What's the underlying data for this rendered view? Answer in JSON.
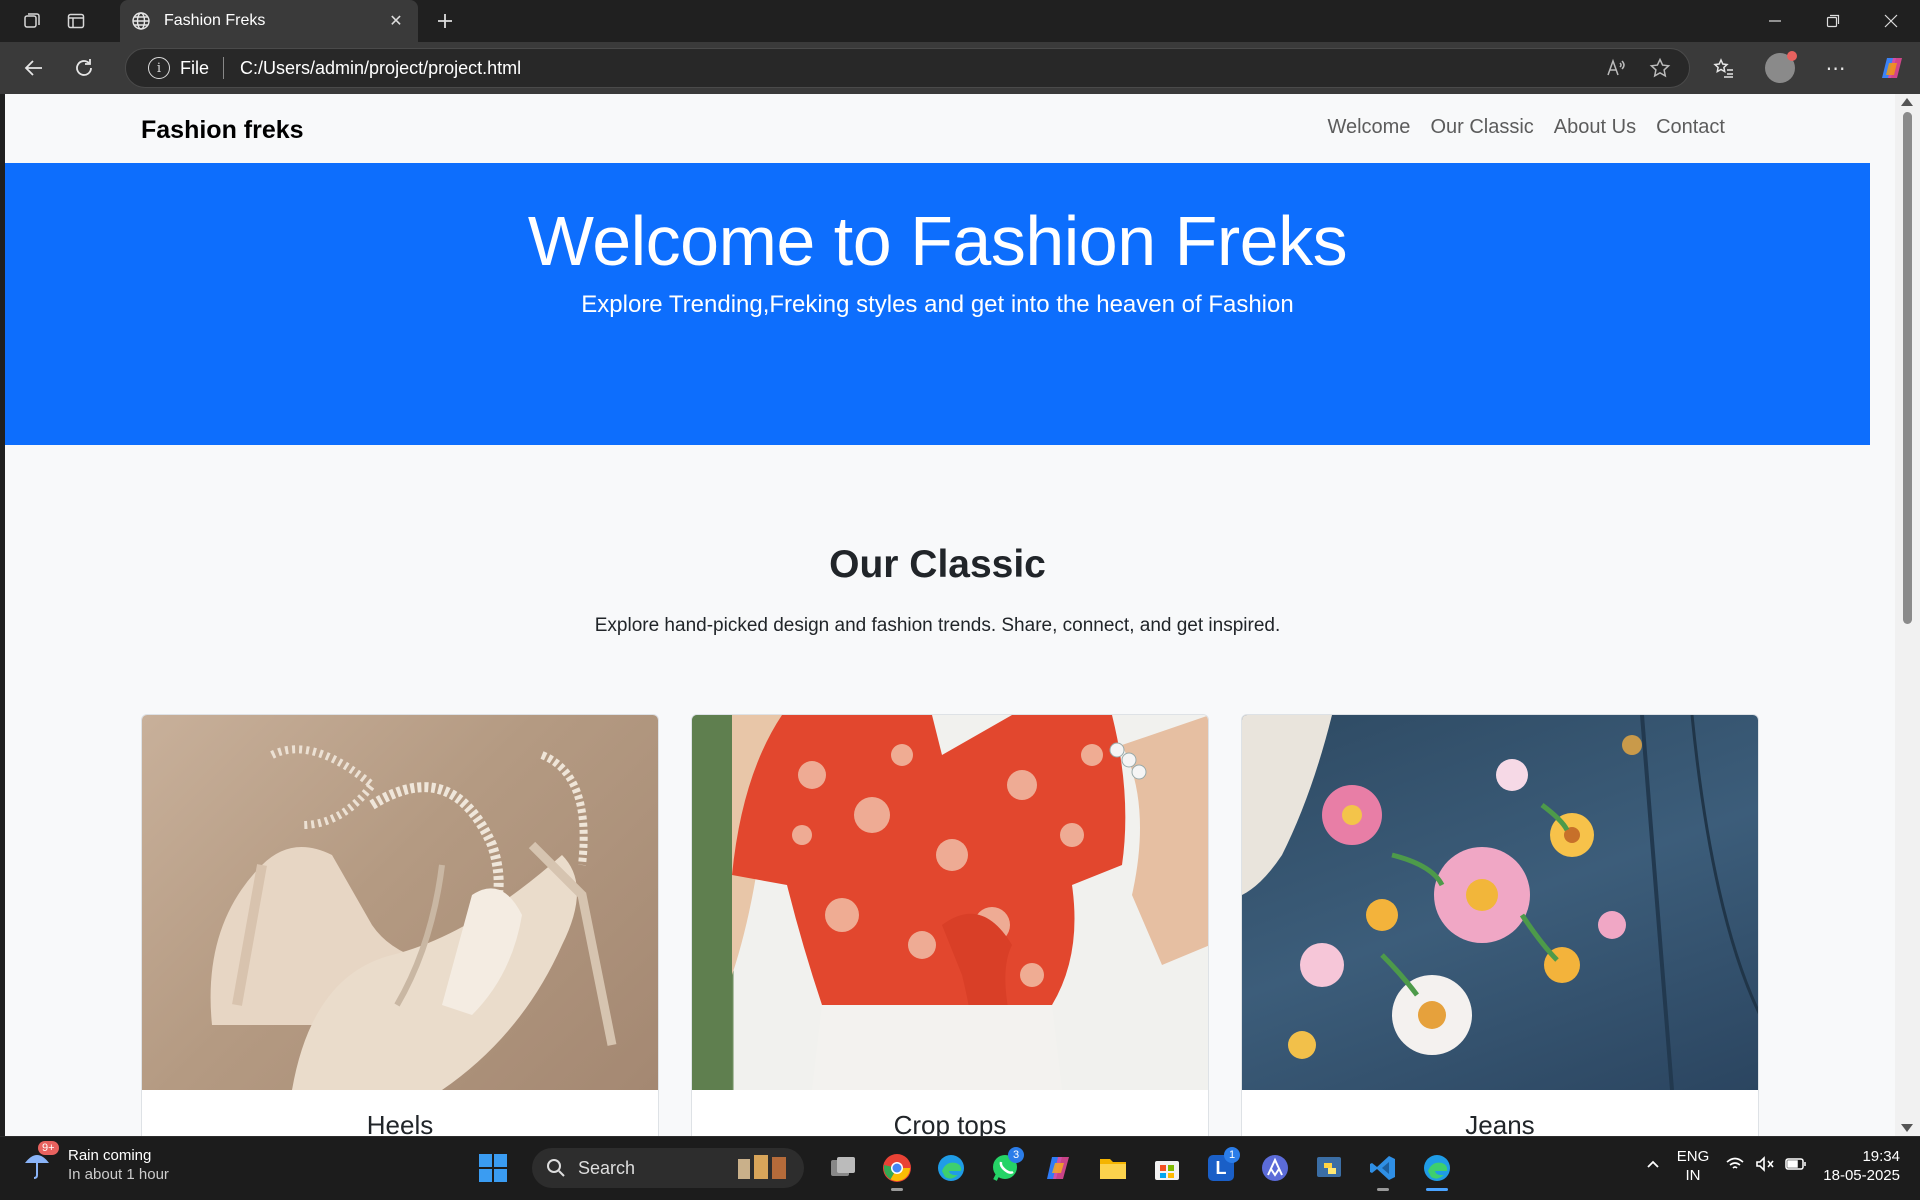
{
  "browser": {
    "tab_title": "Fashion Freks",
    "url_scheme_label": "File",
    "url": "C:/Users/admin/project/project.html"
  },
  "site": {
    "brand": "Fashion freks",
    "nav": [
      "Welcome",
      "Our Classic",
      "About Us",
      "Contact"
    ],
    "hero": {
      "title": "Welcome to Fashion Freks",
      "subtitle": "Explore Trending,Freking styles and get into the heaven of Fashion",
      "bg_color": "#0d6efd"
    },
    "classic": {
      "heading": "Our Classic",
      "text": "Explore hand-picked design and fashion trends. Share, connect, and get inspired."
    },
    "cards": [
      {
        "title": "Heels"
      },
      {
        "title": "Crop tops"
      },
      {
        "title": "Jeans"
      }
    ]
  },
  "taskbar": {
    "weather_badge": "9+",
    "weather_title": "Rain coming",
    "weather_sub": "In about 1 hour",
    "search_label": "Search",
    "whatsapp_badge": "3",
    "l_badge": "1",
    "lang_line1": "ENG",
    "lang_line2": "IN",
    "time": "19:34",
    "date": "18-05-2025"
  }
}
